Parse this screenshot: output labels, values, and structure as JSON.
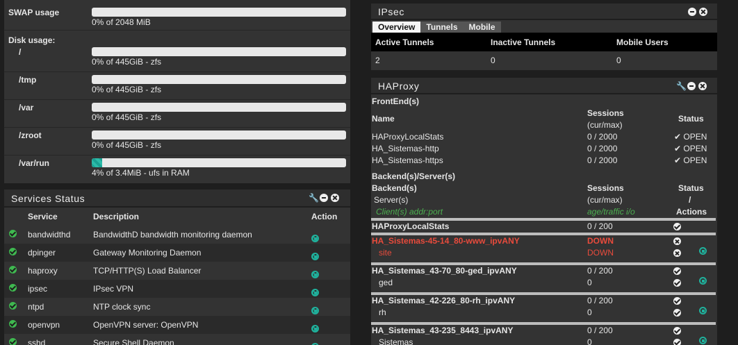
{
  "system": {
    "swap_label": "SWAP usage",
    "swap_text": "0% of 2048 MiB",
    "disk_label": "Disk usage:",
    "disks": [
      {
        "mount": "/",
        "text": "0% of 445GiB - zfs",
        "percent": 0
      },
      {
        "mount": "/tmp",
        "text": "0% of 445GiB - zfs",
        "percent": 0
      },
      {
        "mount": "/var",
        "text": "0% of 445GiB - zfs",
        "percent": 0
      },
      {
        "mount": "/zroot",
        "text": "0% of 445GiB - zfs",
        "percent": 0
      },
      {
        "mount": "/var/run",
        "text": "4% of 3.4MiB - ufs in RAM",
        "percent": 4
      }
    ]
  },
  "services": {
    "title": "Services Status",
    "headers": {
      "service": "Service",
      "description": "Description",
      "action": "Action"
    },
    "rows": [
      {
        "name": "bandwidthd",
        "desc": "BandwidthD bandwidth monitoring daemon"
      },
      {
        "name": "dpinger",
        "desc": "Gateway Monitoring Daemon"
      },
      {
        "name": "haproxy",
        "desc": "TCP/HTTP(S) Load Balancer"
      },
      {
        "name": "ipsec",
        "desc": "IPsec VPN"
      },
      {
        "name": "ntpd",
        "desc": "NTP clock sync"
      },
      {
        "name": "openvpn",
        "desc": "OpenVPN server: OpenVPN"
      },
      {
        "name": "sshd",
        "desc": "Secure Shell Daemon"
      }
    ]
  },
  "ipsec": {
    "title": "IPsec",
    "tabs": [
      "Overview",
      "Tunnels",
      "Mobile"
    ],
    "headers": [
      "Active Tunnels",
      "Inactive Tunnels",
      "Mobile Users"
    ],
    "values": [
      "2",
      "0",
      "0"
    ]
  },
  "haproxy": {
    "title": "HAProxy",
    "frontends_label": "FrontEnd(s)",
    "fe_headers": {
      "name": "Name",
      "sessions": "Sessions",
      "curmax": "(cur/max)",
      "status": "Status"
    },
    "frontends": [
      {
        "name": "HAProxyLocalStats",
        "sessions": "0 / 2000",
        "status": "OPEN"
      },
      {
        "name": "HA_Sistemas-http",
        "sessions": "0 / 2000",
        "status": "OPEN"
      },
      {
        "name": "HA_Sistemas-https",
        "sessions": "0 / 2000",
        "status": "OPEN"
      }
    ],
    "backends_label": "Backend(s)/Server(s)",
    "be_headers": {
      "backend": "Backend(s)",
      "server": "Server(s)",
      "client": "Client(s) addr:port",
      "sessions": "Sessions",
      "curmax": "(cur/max)",
      "age": "age/traffic i/o",
      "status": "Status",
      "slash": "/",
      "actions": "Actions"
    },
    "backends": [
      {
        "name": "HAProxyLocalStats",
        "sessions": "0 / 200",
        "down": false
      },
      {
        "name": "HA_Sistemas-45-14_80-www_ipvANY",
        "sessions": "DOWN",
        "down": true,
        "server": "site",
        "server_sessions": "DOWN"
      },
      {
        "name": "HA_Sistemas_43-70_80-ged_ipvANY",
        "sessions": "0 / 200",
        "down": false,
        "server": "ged",
        "server_sessions": "0"
      },
      {
        "name": "HA_Sistemas_42-226_80-rh_ipvANY",
        "sessions": "0 / 200",
        "down": false,
        "server": "rh",
        "server_sessions": "0"
      },
      {
        "name": "HA_Sistemas_43-235_8443_ipvANY",
        "sessions": "0 / 200",
        "down": false,
        "server": "Sistemas",
        "server_sessions": "0"
      }
    ]
  },
  "colors": {
    "accent": "#1fb29d",
    "ok": "#3fb950",
    "down": "#e84b3c"
  }
}
